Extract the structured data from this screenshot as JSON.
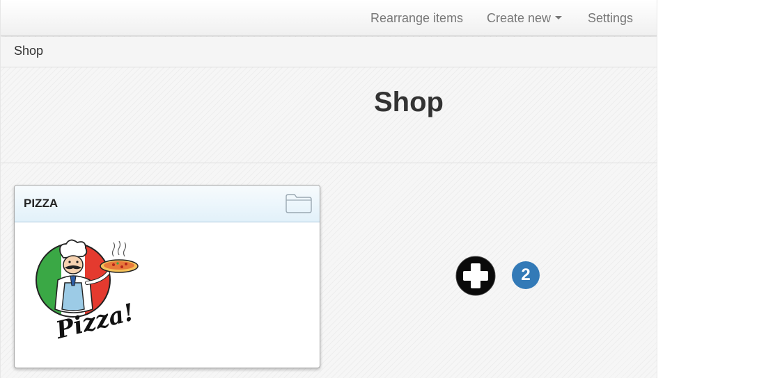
{
  "navbar": {
    "rearrange_label": "Rearrange items",
    "create_new_label": "Create new",
    "settings_label": "Settings"
  },
  "breadcrumb": {
    "current": "Shop"
  },
  "page": {
    "title": "Shop"
  },
  "card": {
    "title": "PIZZA",
    "image_label": "Pizza!"
  },
  "badge": {
    "count": "2"
  },
  "colors": {
    "badge": "#337ab7",
    "card_header_top": "#f7fbfd",
    "card_header_bottom": "#e2f1fa",
    "flag_green": "#3aa845",
    "flag_red": "#e43a2f"
  },
  "icons": {
    "folder": "folder-icon",
    "add": "plus-circle-icon",
    "caret": "caret-down-icon"
  }
}
